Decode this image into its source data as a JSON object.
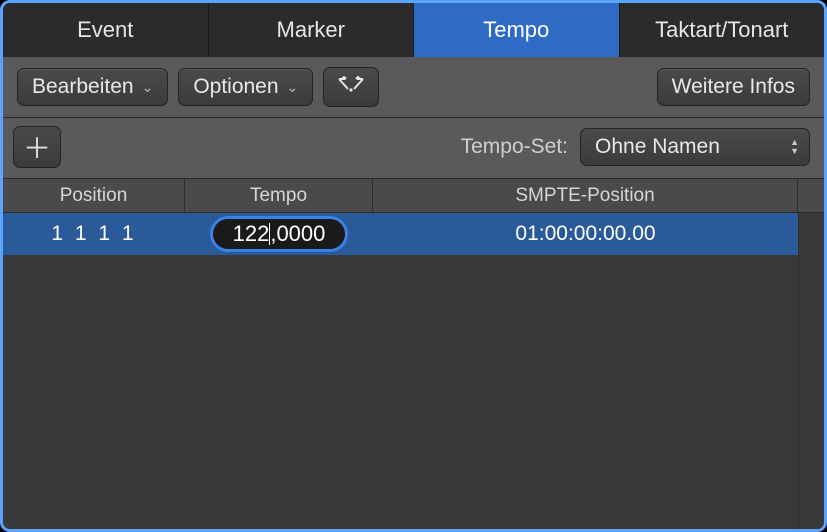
{
  "tabs": [
    {
      "label": "Event",
      "active": false
    },
    {
      "label": "Marker",
      "active": false
    },
    {
      "label": "Tempo",
      "active": true
    },
    {
      "label": "Taktart/Tonart",
      "active": false
    }
  ],
  "toolbar": {
    "edit_label": "Bearbeiten",
    "options_label": "Optionen",
    "more_info_label": "Weitere Infos"
  },
  "tempo_set": {
    "label": "Tempo-Set:",
    "value": "Ohne Namen"
  },
  "columns": {
    "position": "Position",
    "tempo": "Tempo",
    "smpte": "SMPTE-Position"
  },
  "rows": [
    {
      "position_display": "1 1 1    1",
      "tempo_before_cursor": "122",
      "tempo_after_cursor": ",0000",
      "smpte": "01:00:00:00.00",
      "selected": true,
      "editing_tempo": true
    }
  ]
}
